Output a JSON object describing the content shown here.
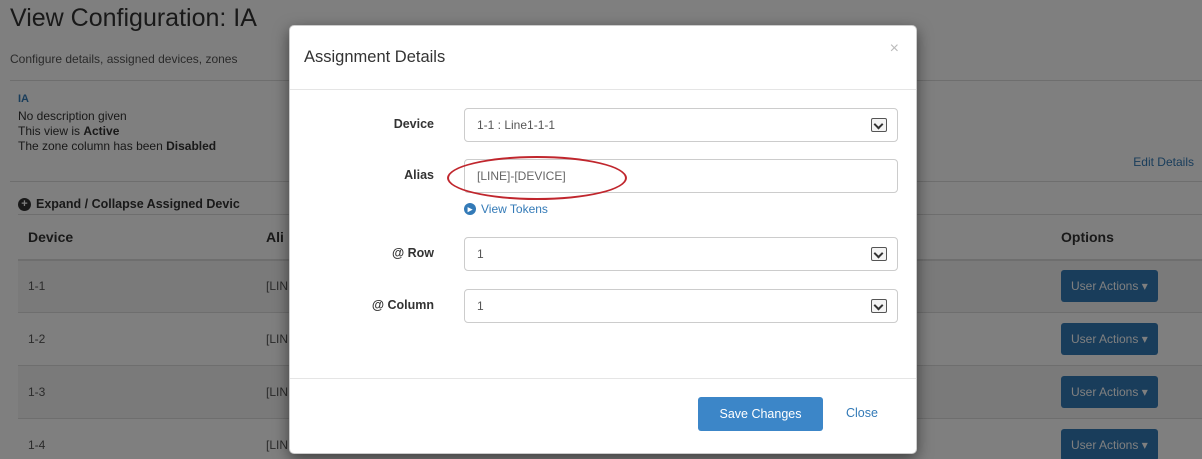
{
  "page": {
    "title": "View Configuration: IA",
    "subtitle": "Configure details, assigned devices, zones"
  },
  "view_info": {
    "name": "IA",
    "description": "No description given",
    "active_prefix": "This view is ",
    "active_value": "Active",
    "zone_prefix": "The zone column has been ",
    "zone_value": "Disabled",
    "edit_link": "Edit Details"
  },
  "assigned_devices": {
    "toggle_label": "Expand / Collapse Assigned Devic",
    "headers": {
      "device": "Device",
      "alias": "Ali",
      "options": "Options"
    },
    "rows": [
      {
        "device": "1-1",
        "alias": "[LIN",
        "action": "User Actions ▾"
      },
      {
        "device": "1-2",
        "alias": "[LIN",
        "action": "User Actions ▾"
      },
      {
        "device": "1-3",
        "alias": "[LIN",
        "action": "User Actions ▾"
      },
      {
        "device": "1-4",
        "alias": "[LIN",
        "action": "User Actions ▾"
      }
    ]
  },
  "modal": {
    "title": "Assignment Details",
    "close_x": "×",
    "device": {
      "label": "Device",
      "value": "1-1 : Line1-1-1"
    },
    "alias": {
      "label": "Alias",
      "value": "[LINE]-[DEVICE]"
    },
    "view_tokens": "View Tokens",
    "row": {
      "label": "@ Row",
      "value": "1"
    },
    "column": {
      "label": "@ Column",
      "value": "1"
    },
    "save_label": "Save Changes",
    "close_label": "Close"
  },
  "colors": {
    "primary": "#337ab7",
    "highlight_ellipse": "#c0262d"
  }
}
